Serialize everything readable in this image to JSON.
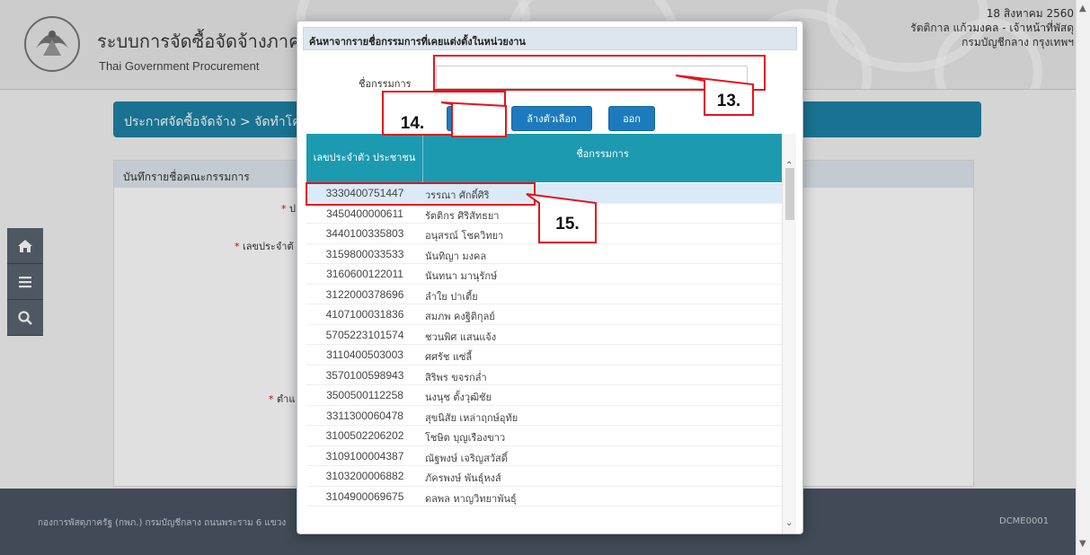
{
  "header": {
    "title": "ระบบการจัดซื้อจัดจ้างภาค",
    "subtitle": "Thai Government Procurement",
    "date": "18 สิงหาคม 2560",
    "user": "รัตติกาล แก้วมงคล - เจ้าหน้าที่พัสดุ",
    "department": "กรมบัญชีกลาง กรุงเทพฯ"
  },
  "breadcrumb": "ประกาศจัดซื้อจัดจ้าง > จัดทำโค",
  "panel": {
    "title": "บันทึกรายชื่อคณะกรรมการ",
    "label_id": "เลขประจำตั",
    "label_position": "ตำแ"
  },
  "footer": {
    "text": "กองการพัสดุภาครัฐ (กพภ.) กรมบัญชีกลาง ถนนพระราม 6 แขวง",
    "code": "DCME0001"
  },
  "modal": {
    "title": "ค้นหาจากรายชื่อกรรมการที่เคยแต่งตั้งในหน่วยงาน",
    "name_label": "ชื่อกรรมการ",
    "name_value": "",
    "buttons": {
      "search": "ค้นหา",
      "clear": "ล้างตัวเลือก",
      "exit": "ออก"
    },
    "columns": [
      "เลขประจำตัว ประชาชน",
      "ชื่อกรรมการ"
    ],
    "rows": [
      {
        "id": "3330400751447",
        "name": "วรรณา ศักดิ์ศิริ"
      },
      {
        "id": "3450400000611",
        "name": "รัตติกร ศิริสัทธยา"
      },
      {
        "id": "3440100335803",
        "name": "อนุสรณ์ โชควิทยา"
      },
      {
        "id": "3159800033533",
        "name": "นันทิญา มงคล"
      },
      {
        "id": "3160600122011",
        "name": "นันทนา มานุรักษ์"
      },
      {
        "id": "3122000378696",
        "name": "ลำใย ปาเตี้ย"
      },
      {
        "id": "4107100031836",
        "name": "สมภพ คงฐิติกุลย์"
      },
      {
        "id": "5705223101574",
        "name": "ชวนพิศ แสนแจ้ง"
      },
      {
        "id": "3110400503003",
        "name": "ศศรัช แซ่ลี้"
      },
      {
        "id": "3570100598943",
        "name": "สิริพร ขจรกล่ำ"
      },
      {
        "id": "3500500112258",
        "name": "นงนุช ตั้งวุฒิชัย"
      },
      {
        "id": "3311300060478",
        "name": "สุขนิสัย เหล่าฤกษ์อุทัย"
      },
      {
        "id": "3100502206202",
        "name": "โชษิต บุญเรืองขาว"
      },
      {
        "id": "3109100004387",
        "name": "ณัฐพงษ์ เจริญสวัสดิ์"
      },
      {
        "id": "3103200006882",
        "name": "ภัครพงษ์ พันธุ์หงส์"
      },
      {
        "id": "3104900069675",
        "name": "ดลพล หาญวิทยาพันธุ์"
      }
    ]
  },
  "annotations": {
    "a13": "13.",
    "a14": "14.",
    "a15": "15."
  },
  "icons": [
    "home-icon",
    "menu-icon",
    "search-icon"
  ],
  "colors": {
    "primary": "#1d82a6",
    "table_header": "#1c9ab0",
    "button": "#1d7bbd",
    "annotation": "#e4141b"
  }
}
